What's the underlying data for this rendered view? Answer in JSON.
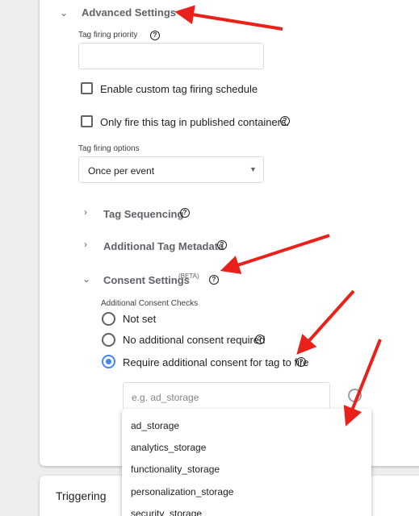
{
  "advanced": {
    "title": "Advanced Settings",
    "priority_label": "Tag firing priority",
    "priority_value": "",
    "custom_schedule_label": "Enable custom tag firing schedule",
    "published_only_label": "Only fire this tag in published containers.",
    "firing_options_label": "Tag firing options",
    "firing_option_value": "Once per event"
  },
  "sections": {
    "tag_sequencing": "Tag Sequencing",
    "tag_metadata": "Additional Tag Metadata",
    "consent_settings": "Consent Settings",
    "consent_beta": "(BETA)"
  },
  "consent": {
    "checks_label": "Additional Consent Checks",
    "options": [
      "Not set",
      "No additional consent required",
      "Require additional consent for tag to fire"
    ],
    "selected_index": 2,
    "input_placeholder": "e.g. ad_storage"
  },
  "dropdown_options": [
    "ad_storage",
    "analytics_storage",
    "functionality_storage",
    "personalization_storage",
    "security_storage"
  ],
  "triggering": {
    "title": "Triggering"
  },
  "help_glyph": "?",
  "colors": {
    "accent": "#4285f4",
    "annotation_arrow": "#e8211b"
  },
  "icons": {
    "expand": "chevron-down-icon",
    "collapsed": "chevron-right-icon",
    "help": "help-icon",
    "dropdown": "triangle-down-icon",
    "remove": "remove-circle-icon"
  }
}
